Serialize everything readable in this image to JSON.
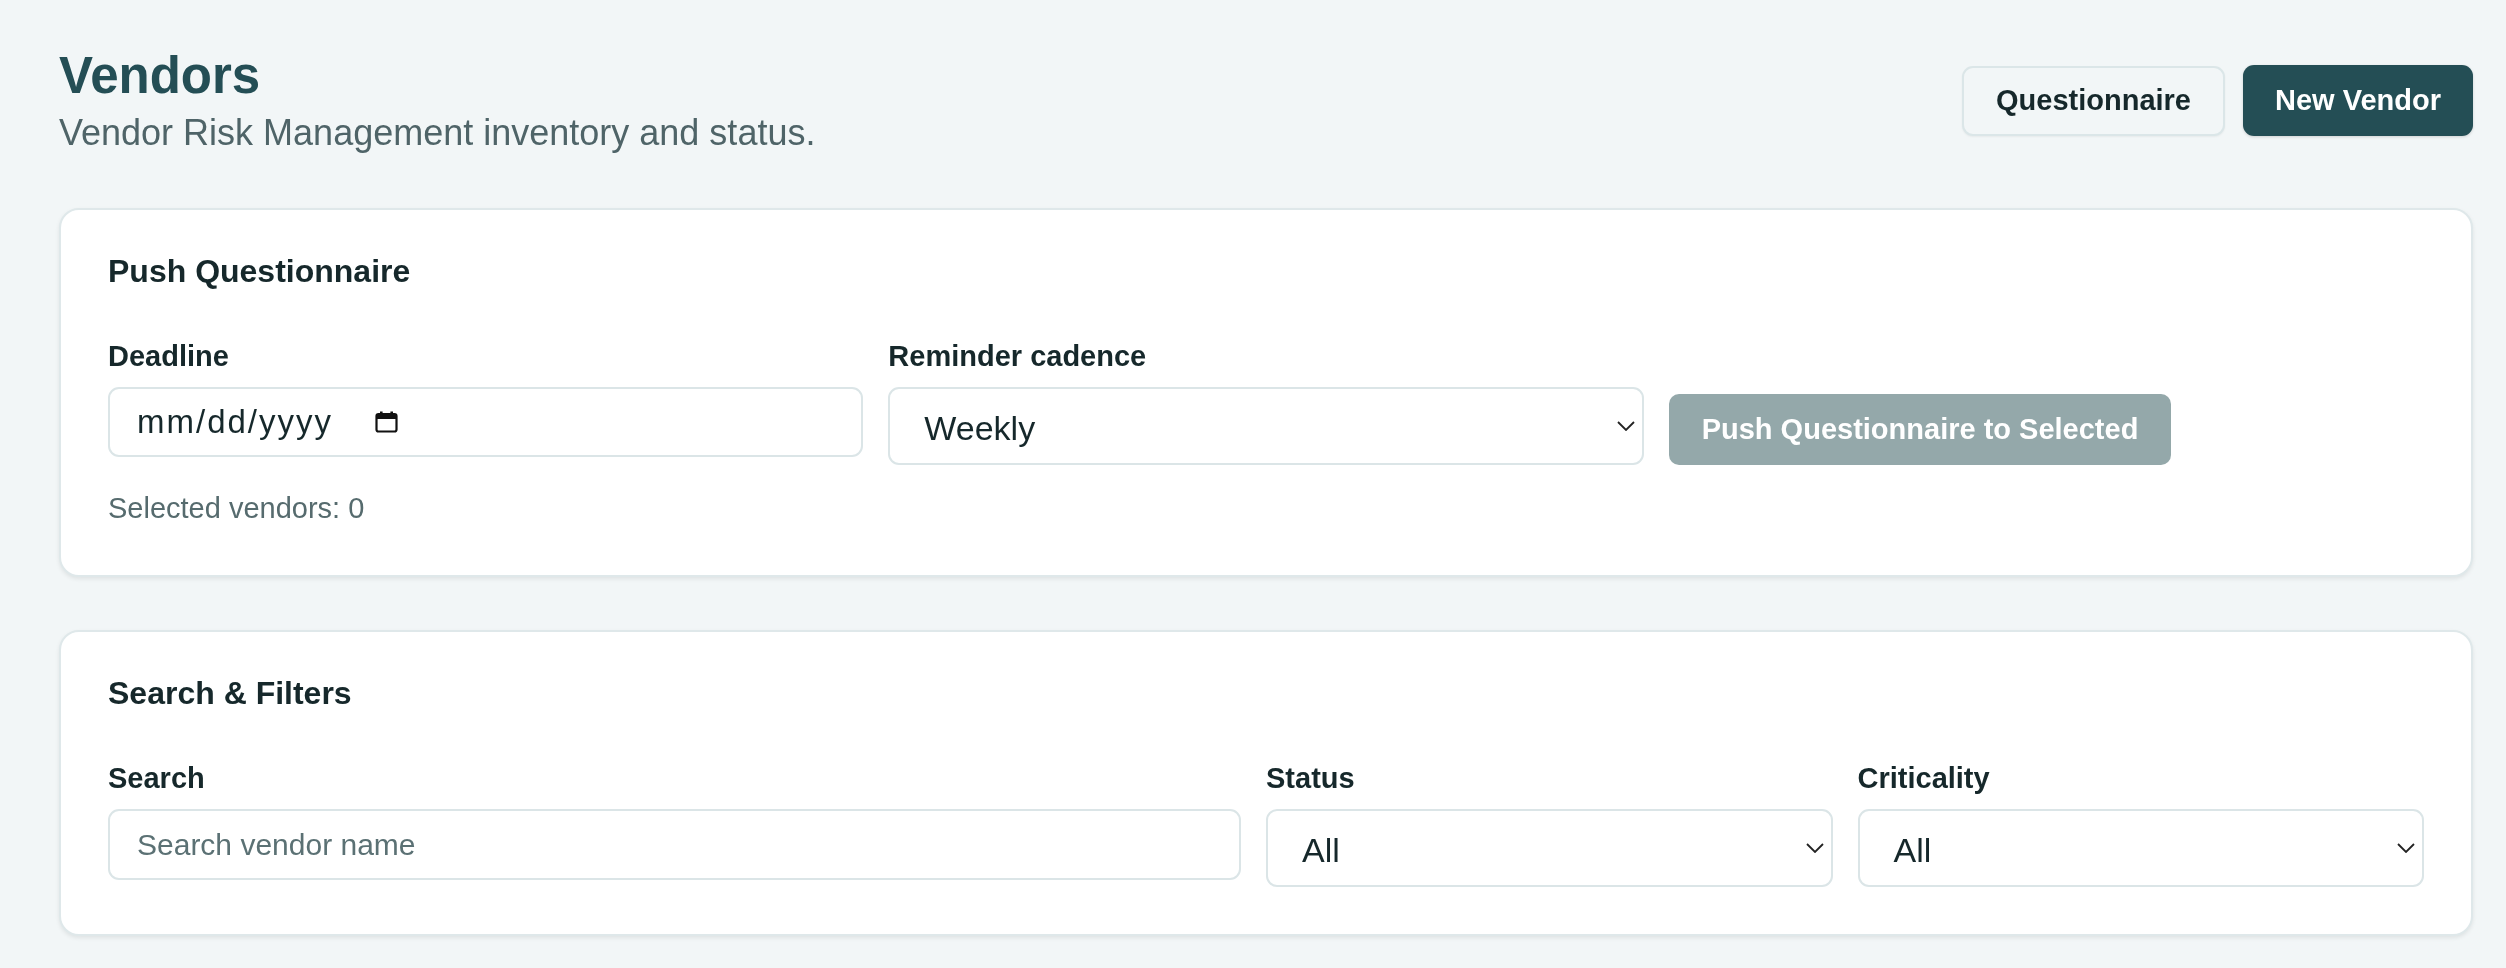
{
  "header": {
    "title": "Vendors",
    "subtitle": "Vendor Risk Management inventory and status.",
    "actions": [
      {
        "label": "Questionnaire",
        "kind": "secondary"
      },
      {
        "label": "New Vendor",
        "kind": "primary"
      }
    ]
  },
  "push_questionnaire": {
    "title": "Push Questionnaire",
    "deadline": {
      "label": "Deadline",
      "placeholder": "mm/dd/yyyy"
    },
    "reminder_cadence": {
      "label": "Reminder cadence",
      "value": "Weekly"
    },
    "push_button": {
      "label": "Push Questionnaire to Selected",
      "disabled": true
    },
    "selected_count": "Selected vendors: 0"
  },
  "search_filters": {
    "title": "Search & Filters",
    "search": {
      "label": "Search",
      "placeholder": "Search vendor name"
    },
    "status": {
      "label": "Status",
      "value": "All"
    },
    "criticality": {
      "label": "Criticality",
      "value": "All"
    }
  }
}
